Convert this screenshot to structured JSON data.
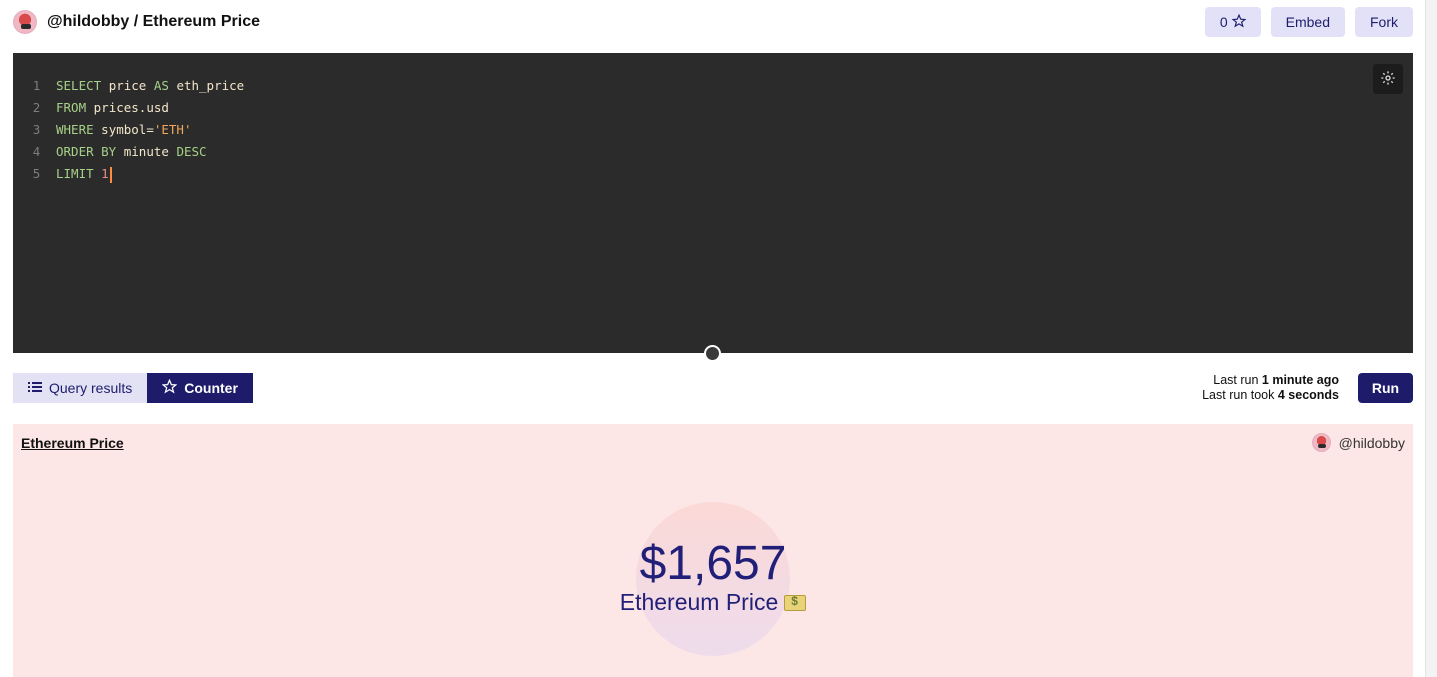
{
  "header": {
    "owner": "@hildobby",
    "separator": " / ",
    "title": "Ethereum Price",
    "star_count": "0",
    "embed_label": "Embed",
    "fork_label": "Fork"
  },
  "editor": {
    "lines": [
      {
        "number": "1"
      },
      {
        "number": "2"
      },
      {
        "number": "3"
      },
      {
        "number": "4"
      },
      {
        "number": "5"
      }
    ],
    "tokens": {
      "l1_kw1": "SELECT",
      "l1_id1": "price",
      "l1_kw2": "AS",
      "l1_id2": "eth_price",
      "l2_kw1": "FROM",
      "l2_id1": "prices.usd",
      "l3_kw1": "WHERE",
      "l3_id1": "symbol=",
      "l3_str": "'ETH'",
      "l4_kw1": "ORDER BY",
      "l4_id1": "minute",
      "l4_kw2": "DESC",
      "l5_kw1": "LIMIT",
      "l5_num": "1"
    }
  },
  "tabs": {
    "query_results": "Query results",
    "counter": "Counter"
  },
  "run": {
    "last_run_prefix": "Last run ",
    "last_run_value": "1 minute ago",
    "took_prefix": "Last run took ",
    "took_value": "4 seconds",
    "run_label": "Run"
  },
  "visualization": {
    "title": "Ethereum Price",
    "owner": "@hildobby",
    "counter_value": "$1,657",
    "counter_label": "Ethereum Price"
  },
  "colors": {
    "accent": "#1e1b6b",
    "pill_bg": "#e2e1f7",
    "viz_bg": "#fde6e6",
    "editor_bg": "#2b2b2b"
  },
  "icons": {
    "star": "star-icon",
    "settings": "gear-icon",
    "list": "list-icon",
    "money": "money-icon"
  }
}
